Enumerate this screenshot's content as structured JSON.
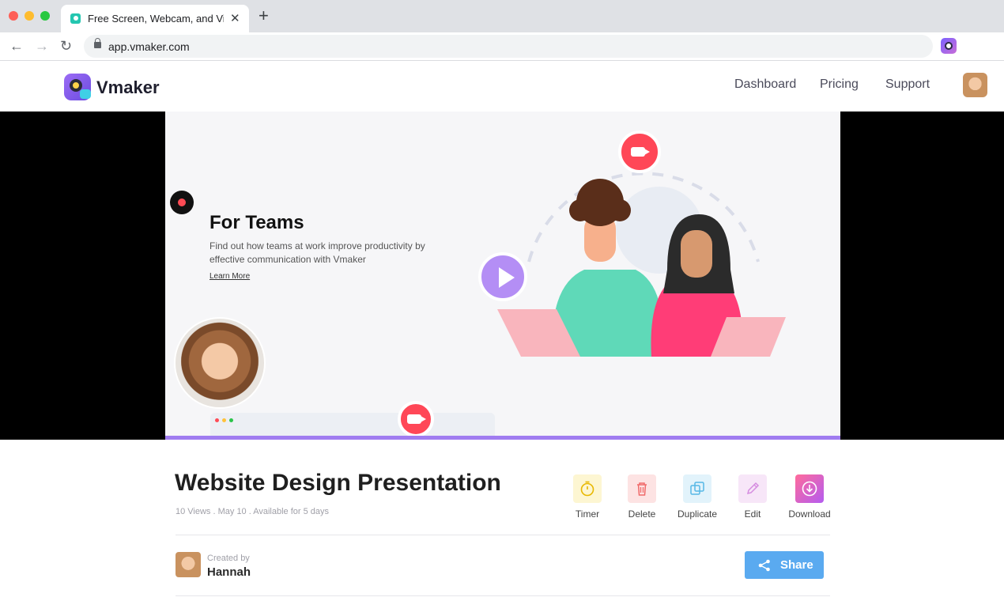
{
  "browser": {
    "tab_title": "Free Screen, Webcam, and Video Recorder",
    "tab_close": "✕",
    "new_tab": "+",
    "url": "app.vmaker.com",
    "back": "←",
    "forward": "→",
    "reload": "↻"
  },
  "header": {
    "logo_text": "Vmaker",
    "nav": [
      "Dashboard",
      "Pricing",
      "Support"
    ]
  },
  "player": {
    "slide_title": "For Teams",
    "slide_description": "Find out how teams at work improve productivity by effective communication with Vmaker",
    "slide_link": "Learn More",
    "progress_fraction": 1.0
  },
  "video": {
    "title": "Website Design Presentation",
    "meta": "10 Views . May 10 . Available for 5 days"
  },
  "actions": {
    "timer": "Timer",
    "delete": "Delete",
    "duplicate": "Duplicate",
    "edit": "Edit",
    "download": "Download"
  },
  "creator": {
    "label": "Created by",
    "name": "Hannah"
  },
  "share": {
    "label": "Share"
  },
  "colors": {
    "accent": "#a07cf0",
    "share": "#5aaaf0",
    "record": "#ff4757"
  }
}
